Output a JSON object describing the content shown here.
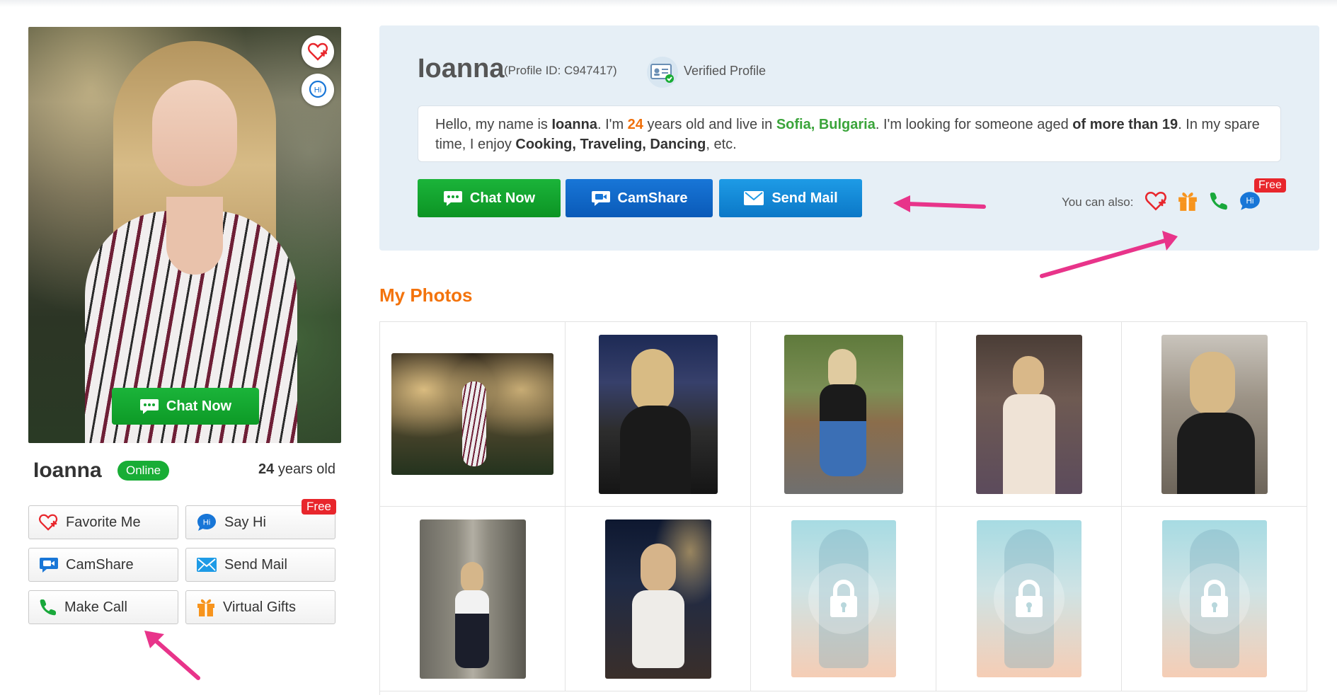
{
  "profile": {
    "name": "Ioanna",
    "status": "Online",
    "age_number": "24",
    "age_suffix": " years old",
    "profile_id_text": "(Profile ID: C947417)",
    "verified_text": "Verified Profile"
  },
  "photo_overlay": {
    "chat_label": "Chat Now"
  },
  "left_actions": {
    "favorite": "Favorite Me",
    "say_hi": "Say Hi",
    "free_tag": "Free",
    "camshare": "CamShare",
    "send_mail": "Send Mail",
    "make_call": "Make Call",
    "virtual_gifts": "Virtual Gifts"
  },
  "bio": {
    "p1": "Hello, my name is ",
    "name": "Ioanna",
    "p2": ". I'm ",
    "age": "24",
    "p3": " years old and live in ",
    "city": "Sofia, Bulgaria",
    "p4": ". I'm looking for someone aged ",
    "aged": "of more than 19",
    "p5": ". In my spare time, I enjoy ",
    "hobbies": "Cooking, Traveling, Dancing",
    "p6": ", etc."
  },
  "panel_buttons": {
    "chat": "Chat Now",
    "camshare": "CamShare",
    "send_mail": "Send Mail"
  },
  "also": {
    "label": "You can also:",
    "free_tag": "Free",
    "icons": [
      "heart-plus-icon",
      "gift-icon",
      "phone-icon",
      "hi-bubble-icon"
    ]
  },
  "photos": {
    "title": "My Photos",
    "hi_text": "Hi"
  },
  "colors": {
    "green": "#1bb43a",
    "blue": "#1876d7",
    "light_blue": "#1e9be6",
    "orange": "#f3730c",
    "red": "#e8262c",
    "pink_arrow": "#e8348a"
  }
}
